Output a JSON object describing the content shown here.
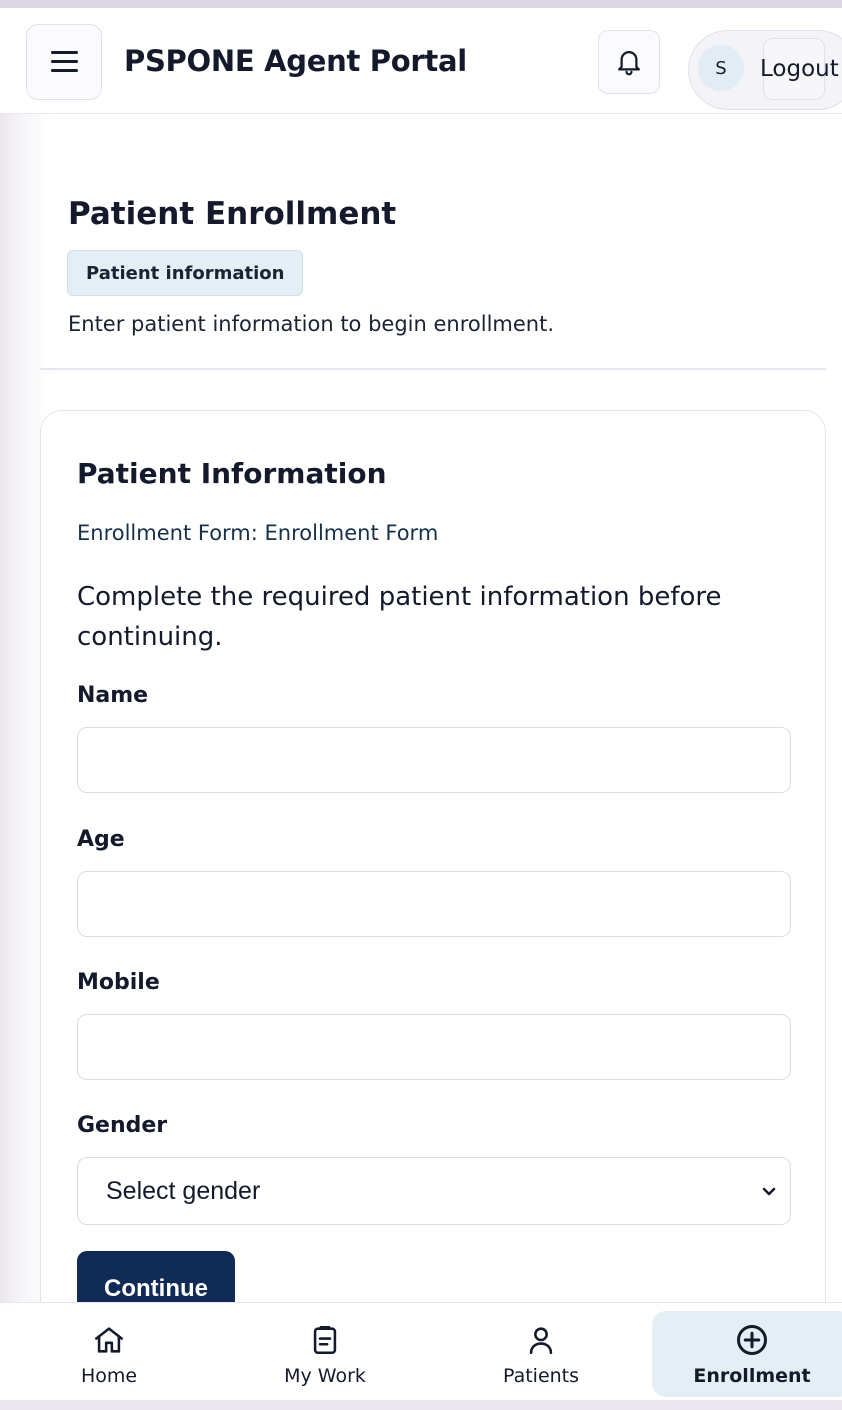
{
  "header": {
    "app_title": "PSPONE Agent Portal",
    "menu_icon": "hamburger-menu-icon",
    "notification_icon": "bell-icon",
    "avatar_initial": "S",
    "logout_label": "Logout"
  },
  "page": {
    "title": "Patient Enrollment",
    "step_badge": "Patient information",
    "subtitle": "Enter patient information to begin enrollment."
  },
  "card": {
    "title": "Patient Information",
    "form_name": "Enrollment Form: Enrollment Form",
    "description": "Complete the required patient information before continuing.",
    "fields": {
      "name": {
        "label": "Name",
        "value": ""
      },
      "age": {
        "label": "Age",
        "value": ""
      },
      "mobile": {
        "label": "Mobile",
        "value": ""
      },
      "gender": {
        "label": "Gender",
        "selected": "Select gender"
      }
    },
    "continue_label": "Continue"
  },
  "bottom_nav": {
    "items": [
      {
        "label": "Home",
        "icon": "home-icon",
        "active": false
      },
      {
        "label": "My Work",
        "icon": "clipboard-icon",
        "active": false
      },
      {
        "label": "Patients",
        "icon": "person-icon",
        "active": false
      },
      {
        "label": "Enrollment",
        "icon": "plus-circle-icon",
        "active": true
      }
    ]
  },
  "colors": {
    "primary": "#0f2a55",
    "accent_bg": "#e4eef5",
    "border": "#dfe2ea",
    "text": "#141a2b"
  }
}
